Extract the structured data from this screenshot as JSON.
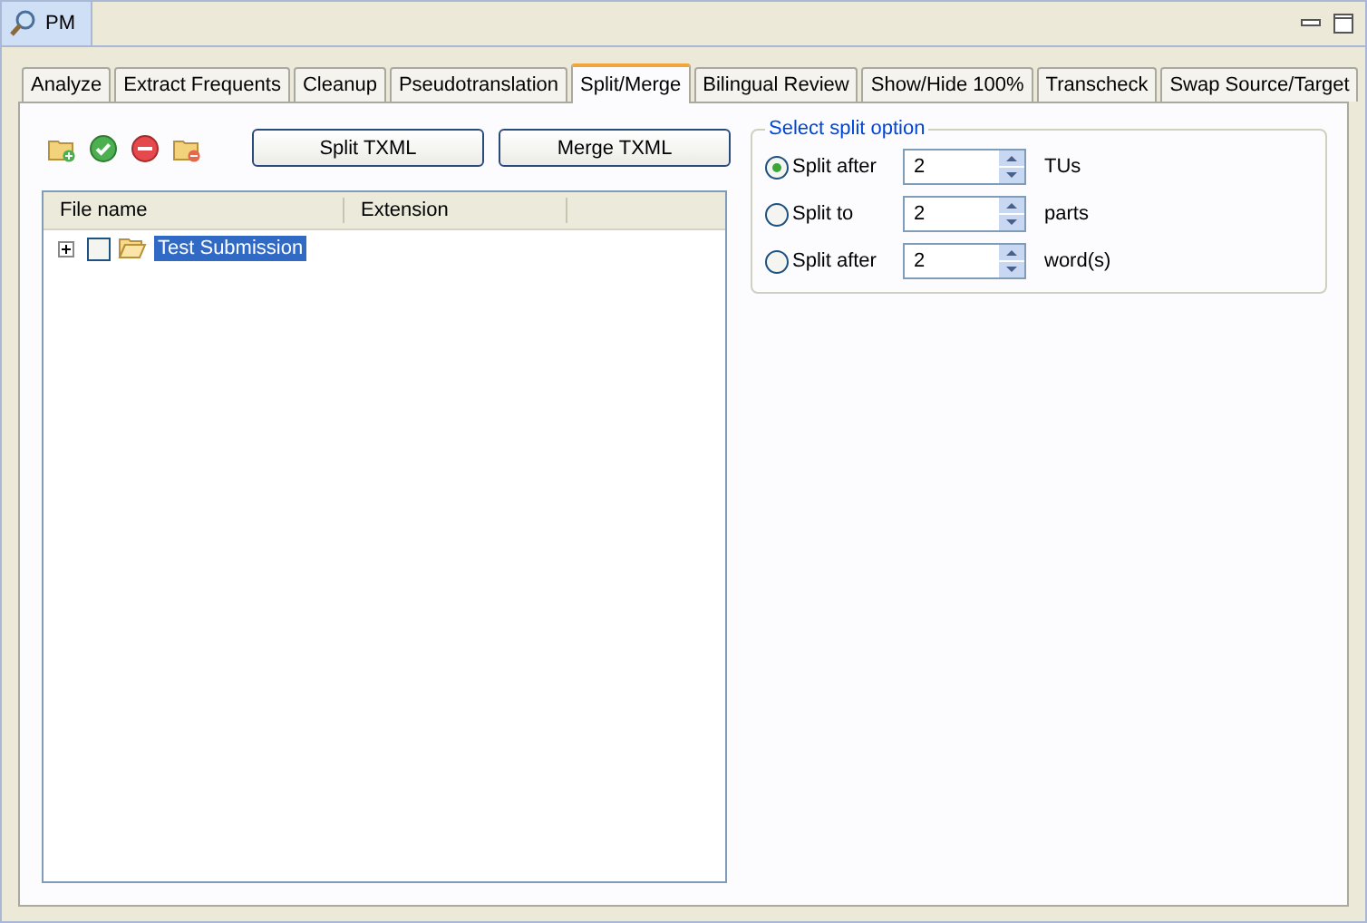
{
  "view": {
    "title": "PM"
  },
  "tabs": [
    {
      "label": "Analyze",
      "selected": false
    },
    {
      "label": "Extract Frequents",
      "selected": false
    },
    {
      "label": "Cleanup",
      "selected": false
    },
    {
      "label": "Pseudotranslation",
      "selected": false
    },
    {
      "label": "Split/Merge",
      "selected": true
    },
    {
      "label": "Bilingual Review",
      "selected": false
    },
    {
      "label": "Show/Hide 100%",
      "selected": false
    },
    {
      "label": "Transcheck",
      "selected": false
    },
    {
      "label": "Swap Source/Target",
      "selected": false
    }
  ],
  "buttons": [
    "Split TXML",
    "Merge TXML"
  ],
  "table": {
    "columns": [
      "File name",
      "Extension"
    ],
    "rows": [
      {
        "name": "Test Submission",
        "expanded": false,
        "checked": false,
        "selected": true
      }
    ]
  },
  "split_options": {
    "title": "Select split option",
    "options": [
      {
        "label": "Split after",
        "value": "2",
        "unit": "TUs",
        "selected": true
      },
      {
        "label": "Split to",
        "value": "2",
        "unit": "parts",
        "selected": false
      },
      {
        "label": "Split after",
        "value": "2",
        "unit": "word(s)",
        "selected": false
      }
    ]
  }
}
